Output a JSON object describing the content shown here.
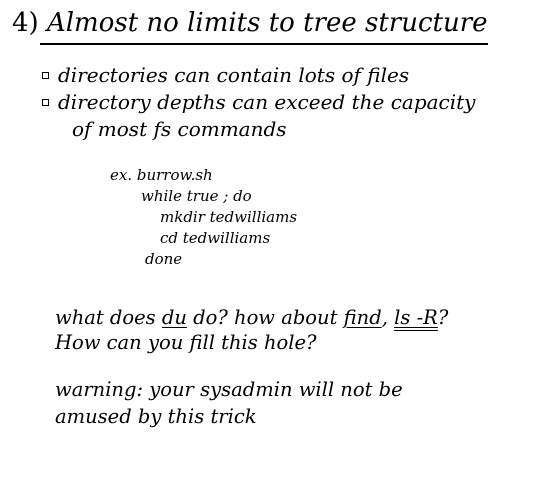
{
  "slide": {
    "title_number": "4)",
    "title_text": "Almost no limits to tree structure",
    "bullets": [
      {
        "line1": "directories can contain lots of files",
        "line2": ""
      },
      {
        "line1": "directory depths can exceed the capacity",
        "line2": "of most fs commands"
      }
    ],
    "code_lines": [
      "ex. burrow.sh",
      "while true ; do",
      "mkdir tedwilliams",
      "cd tedwilliams",
      "done"
    ],
    "question": {
      "part1": "what does ",
      "du": "du",
      "part2": " do? how about ",
      "find": "find",
      "comma": ", ",
      "ls": "ls -R",
      "qmark": "?",
      "line2": "How can you fill this hole?"
    },
    "warning": {
      "line1": "warning: your sysadmin will not be",
      "line2": "amused by this trick"
    }
  }
}
